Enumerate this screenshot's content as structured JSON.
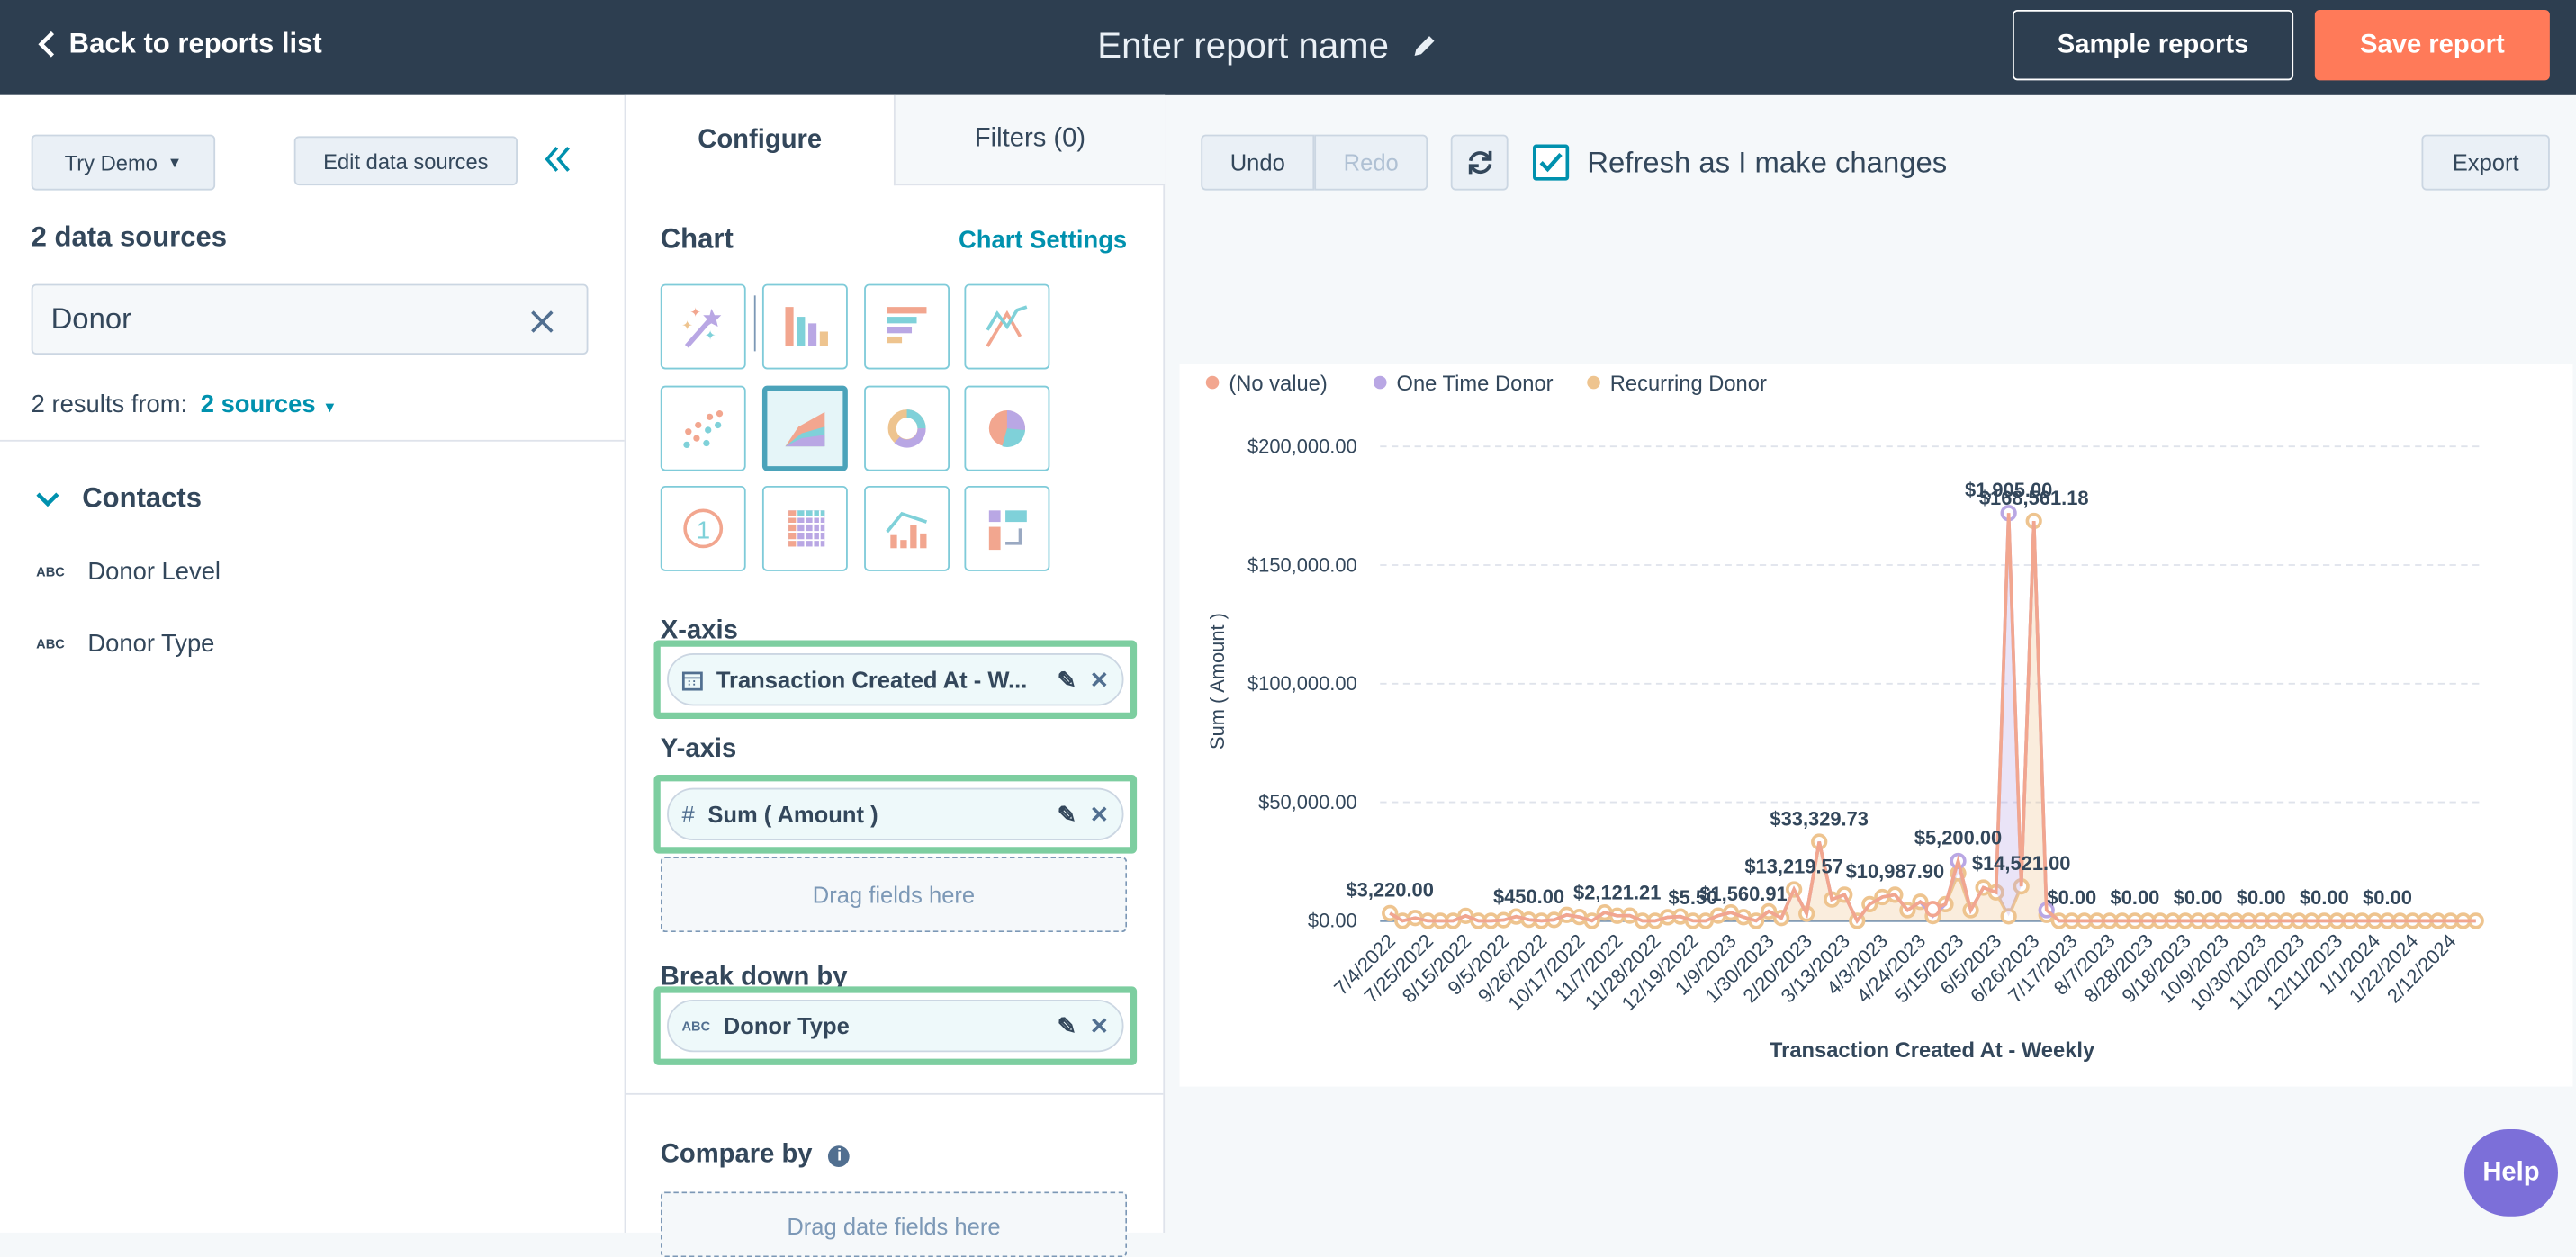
{
  "header": {
    "back_label": "Back to reports list",
    "title_placeholder": "Enter report name",
    "sample_label": "Sample reports",
    "save_label": "Save report"
  },
  "left": {
    "try_demo": "Try Demo",
    "edit_sources": "Edit data sources",
    "sources_heading": "2 data sources",
    "search_value": "Donor",
    "results_prefix": "2 results from:",
    "results_link": "2 sources",
    "group": "Contacts",
    "items": [
      {
        "type": "ABC",
        "label": "Donor Level"
      },
      {
        "type": "ABC",
        "label": "Donor Type"
      }
    ]
  },
  "middle": {
    "tabs": [
      {
        "label": "Configure",
        "active": true
      },
      {
        "label": "Filters (0)",
        "active": false
      }
    ],
    "chart_heading": "Chart",
    "chart_settings": "Chart Settings",
    "chart_types": [
      "magic-wand",
      "vertical-bar",
      "horizontal-bar",
      "line",
      "scatter",
      "area",
      "donut",
      "pie",
      "summary",
      "pivot-table",
      "combination",
      "sankey"
    ],
    "selected_chart_type": "area",
    "x_axis_label": "X-axis",
    "x_axis_field": "Transaction Created At - W...",
    "y_axis_label": "Y-axis",
    "y_axis_field": "Sum ( Amount )",
    "drag_fields": "Drag fields here",
    "breakdown_label": "Break down by",
    "breakdown_field": "Donor Type",
    "compare_label": "Compare by",
    "drag_date_fields": "Drag date fields here"
  },
  "toolbar": {
    "undo": "Undo",
    "redo": "Redo",
    "refresh_checkbox_label": "Refresh as I make changes",
    "refresh_checked": true,
    "export": "Export"
  },
  "help": "Help",
  "colors": {
    "topbar": "#2d3e50",
    "save": "#ff7a59",
    "accent": "#0091ae",
    "highlight": "#7dcea0"
  },
  "chart_data": {
    "type": "area",
    "stacked": true,
    "xlabel": "Transaction Created At - Weekly",
    "ylabel": "Sum ( Amount )",
    "ylim": [
      0,
      200000
    ],
    "yticks": [
      "$0.00",
      "$50,000.00",
      "$100,000.00",
      "$150,000.00",
      "$200,000.00"
    ],
    "grid": true,
    "legend_position": "top-left",
    "x_start": "7/4/2022",
    "x_interval": "weekly",
    "points": 87,
    "xtick_labels": [
      "7/4/2022",
      "7/25/2022",
      "8/15/2022",
      "9/5/2022",
      "9/26/2022",
      "10/17/2022",
      "11/7/2022",
      "11/28/2022",
      "12/19/2022",
      "1/9/2023",
      "1/30/2023",
      "2/20/2023",
      "3/13/2023",
      "4/3/2023",
      "4/24/2023",
      "5/15/2023",
      "6/5/2023",
      "6/26/2023",
      "7/17/2023",
      "8/7/2023",
      "8/28/2023",
      "9/18/2023",
      "10/9/2023",
      "10/30/2023",
      "11/20/2023",
      "12/11/2023",
      "1/1/2024",
      "1/22/2024",
      "2/12/2024"
    ],
    "series": [
      {
        "name": "(No value)",
        "color": "#f2a68f",
        "values": [
          0,
          0,
          0,
          0,
          0,
          0,
          0,
          0,
          0,
          0,
          0,
          0,
          0,
          0,
          0,
          0,
          0,
          0,
          0,
          0,
          0,
          0,
          0,
          0,
          0,
          0,
          0,
          0,
          0,
          0,
          0,
          0,
          0,
          0,
          0,
          0,
          0,
          0,
          0,
          0,
          0,
          0,
          0,
          3000,
          0,
          0,
          0,
          0,
          0,
          0,
          0,
          0,
          0,
          0,
          0,
          0,
          0,
          0,
          0,
          0,
          0,
          0,
          0,
          0,
          0,
          0,
          0,
          0,
          0,
          0,
          0,
          0,
          0,
          0,
          0,
          0,
          0,
          0,
          0,
          0,
          0,
          0,
          0,
          0,
          0,
          0,
          0
        ]
      },
      {
        "name": "One Time Donor",
        "color": "#b9a7e4",
        "values": [
          0,
          0,
          0,
          0,
          0,
          0,
          0,
          0,
          0,
          0,
          0,
          0,
          0,
          0,
          0,
          0,
          0,
          0,
          0,
          0,
          0,
          0,
          0,
          0,
          0,
          0,
          0,
          0,
          0,
          0,
          0,
          0,
          0,
          0,
          0,
          0,
          0,
          0,
          0,
          0,
          0,
          0,
          0,
          0,
          0,
          5200,
          0,
          0,
          0,
          170000,
          0,
          0,
          2000,
          0,
          0,
          0,
          0,
          0,
          0,
          0,
          0,
          0,
          0,
          0,
          0,
          0,
          0,
          0,
          0,
          0,
          0,
          0,
          0,
          0,
          0,
          0,
          0,
          0,
          0,
          0,
          0,
          0,
          0,
          0,
          0,
          0,
          0
        ]
      },
      {
        "name": "Recurring Donor",
        "color": "#eec48f",
        "values": [
          3220,
          0,
          1200,
          0,
          0,
          0,
          2100,
          0,
          0,
          300,
          1800,
          450,
          0,
          400,
          2500,
          1600,
          0,
          3500,
          2121.21,
          2200,
          0,
          0,
          1500,
          1800,
          5.5,
          0,
          2200,
          3500,
          1560.91,
          0,
          4000,
          1200,
          13219.57,
          3000,
          33329.73,
          9000,
          11000,
          0,
          7000,
          10000,
          10987.9,
          4500,
          8000,
          2000,
          7000,
          20000,
          4500,
          14000,
          12000,
          1905,
          14521,
          168561.18,
          2500,
          0,
          0,
          0,
          0,
          0,
          0,
          0,
          0,
          0,
          0,
          0,
          0,
          0,
          0,
          0,
          0,
          0,
          0,
          0,
          0,
          0,
          0,
          0,
          0,
          0,
          0,
          0,
          0,
          0,
          0,
          0,
          0,
          0,
          0
        ]
      }
    ],
    "data_labels": [
      {
        "index": 0,
        "text": "$3,220.00"
      },
      {
        "index": 11,
        "text": "$450.00"
      },
      {
        "index": 18,
        "text": "$2,121.21"
      },
      {
        "index": 24,
        "text": "$5.50"
      },
      {
        "index": 28,
        "text": "$1,560.91"
      },
      {
        "index": 32,
        "text": "$13,219.57"
      },
      {
        "index": 34,
        "text": "$33,329.73"
      },
      {
        "index": 40,
        "text": "$10,987.90"
      },
      {
        "index": 45,
        "text": "$5,200.00"
      },
      {
        "index": 49,
        "text": "$1,905.00"
      },
      {
        "index": 50,
        "text": "$14,521.00"
      },
      {
        "index": 51,
        "text": "$168,561.18"
      },
      {
        "index": 54,
        "text": "$0.00"
      },
      {
        "index": 59,
        "text": "$0.00"
      },
      {
        "index": 64,
        "text": "$0.00"
      },
      {
        "index": 69,
        "text": "$0.00"
      },
      {
        "index": 74,
        "text": "$0.00"
      },
      {
        "index": 79,
        "text": "$0.00"
      }
    ]
  }
}
